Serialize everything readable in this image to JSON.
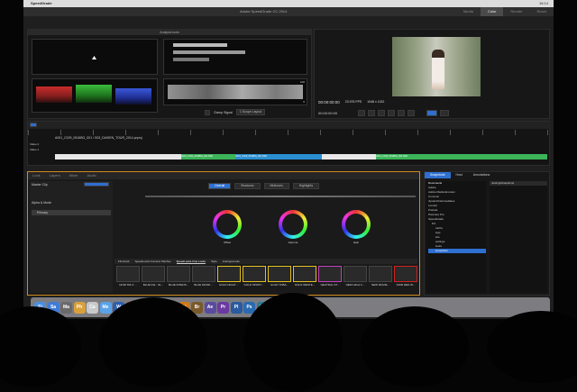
{
  "menubar": {
    "app": "SpeedGrade",
    "right": "16:14"
  },
  "window": {
    "title": "Adobe SpeedGrade CC 2014"
  },
  "tabs": [
    {
      "label": "Media"
    },
    {
      "label": "Color"
    },
    {
      "label": "Render"
    },
    {
      "label": "Reset"
    }
  ],
  "scopes": {
    "header": "Analysis tools",
    "luma_top": "100",
    "luma_bottom": "0",
    "clamp": "Clamp Signal",
    "layout": "1 Scope Layout"
  },
  "viewer": {
    "timecode": "00:00:00:00",
    "fps": "23.976 FPS",
    "res": "1048 x 1152",
    "end_timecode": "00:00:00:00"
  },
  "timeline": {
    "clip_name": "A001_C029_0516BG_001 / S03_DAISEN_TOUR_2014.prproj",
    "tracks": [
      "Video 2",
      "Video 1"
    ],
    "clips": [
      "A001_C031_0516BG_001.R3D",
      "A001_C028_0516BG_001.R3D",
      "A001_C029_0516BG_001.R3D"
    ]
  },
  "grading": {
    "tabs": [
      {
        "label": "Look"
      },
      {
        "label": "Layers"
      },
      {
        "label": "Mixer"
      },
      {
        "label": "Audio"
      }
    ],
    "layer_name": "Master Clip",
    "layer_mode": "Alpha & Mode",
    "layer_item": "Primary",
    "tone_tabs": [
      {
        "label": "Overall"
      },
      {
        "label": "Shadows"
      },
      {
        "label": "Midtones"
      },
      {
        "label": "Highlights"
      }
    ],
    "wheels": [
      {
        "label": "Offset"
      },
      {
        "label": "Gamma"
      },
      {
        "label": "Gain"
      }
    ]
  },
  "looks": {
    "tabs": [
      {
        "label": "Filmstock"
      },
      {
        "label": "SpeedLooks Camera Patches"
      },
      {
        "label": "SpeedLooks Cine Looks"
      },
      {
        "label": "Style"
      },
      {
        "label": "JustingsLooks"
      }
    ],
    "items": [
      {
        "label": "NOIR TRI-X ..."
      },
      {
        "label": "BLUE ICE - SL..."
      },
      {
        "label": "BLUE INTENS..."
      },
      {
        "label": "BLUE MOOD ..."
      },
      {
        "label": "GOLD NIGHT ..."
      },
      {
        "label": "GOLD SPORT ..."
      },
      {
        "label": "GOLD TOBA..."
      },
      {
        "label": "GOLD WESTE..."
      },
      {
        "label": "NEUTRAL ST..."
      },
      {
        "label": "NEW HIGH C..."
      },
      {
        "label": "NEW MOVIE..."
      },
      {
        "label": "NOIR RED W..."
      }
    ]
  },
  "browser": {
    "tabs": [
      {
        "label": "Snapshots"
      },
      {
        "label": "Host"
      },
      {
        "label": "Annotations"
      }
    ],
    "folder_header": "Documents",
    "folders": [
      {
        "label": "Adobe"
      },
      {
        "label": "Adobe Media Encoder"
      },
      {
        "label": "Common"
      },
      {
        "label": "dynamicIntermediates"
      },
      {
        "label": "Lumetri"
      },
      {
        "label": "Prelude"
      },
      {
        "label": "Premiere Pro"
      },
      {
        "label": "SpeedGrade"
      },
      {
        "label": "8.0"
      },
      {
        "label": "cache"
      },
      {
        "label": "logs"
      },
      {
        "label": "luts"
      },
      {
        "label": "settings"
      },
      {
        "label": "looks"
      },
      {
        "label": "snapshots"
      }
    ],
    "snapshot_header": "JustingsSnapshots"
  },
  "dock": [
    {
      "label": "Fi",
      "color": "#4a8fe0"
    },
    {
      "label": "Sa",
      "color": "#3f7bd8"
    },
    {
      "label": "Ma",
      "color": "#6a6a6a"
    },
    {
      "label": "Ph",
      "color": "#d9a03a"
    },
    {
      "label": "Ca",
      "color": "#c9c9c9"
    },
    {
      "label": "Me",
      "color": "#5aa3e8"
    },
    {
      "label": "W",
      "color": "#2b5fb0"
    },
    {
      "label": "P",
      "color": "#c04525"
    },
    {
      "label": "X",
      "color": "#2b8a3e"
    },
    {
      "label": "Ke",
      "color": "#3a8ee0"
    },
    {
      "label": "Id",
      "color": "#c4306a"
    },
    {
      "label": "Ai",
      "color": "#d0781a"
    },
    {
      "label": "Br",
      "color": "#7a5a2a"
    },
    {
      "label": "Ae",
      "color": "#5a4aa0"
    },
    {
      "label": "Pr",
      "color": "#6a3aa0"
    },
    {
      "label": "Pl",
      "color": "#2a5aa0"
    },
    {
      "label": "Ps",
      "color": "#2a6ab0"
    },
    {
      "label": "Sg",
      "color": "#2a7a9a"
    },
    {
      "label": "Au",
      "color": "#2a8a6a"
    },
    {
      "label": "Dw",
      "color": "#3a8a3a"
    },
    {
      "label": "Mu",
      "color": "#a07a1a"
    },
    {
      "label": "Lr",
      "color": "#4a6a8a"
    }
  ]
}
